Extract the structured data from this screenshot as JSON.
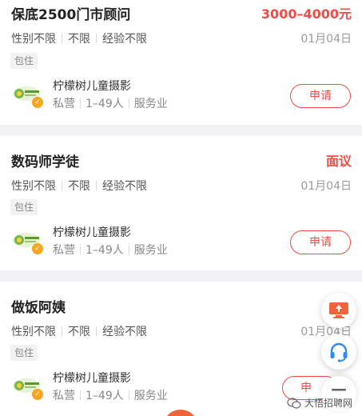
{
  "listings": [
    {
      "title": "保底2500门市顾问",
      "salary": "3000–4000元",
      "requirements": [
        "性别不限",
        "不限",
        "经验不限"
      ],
      "date": "01月04日",
      "tag": "包住",
      "company": {
        "name": "柠檬树儿童摄影",
        "type": "私营",
        "size": "1–49人",
        "industry": "服务业"
      },
      "apply_label": "申请"
    },
    {
      "title": "数码师学徒",
      "salary": "面议",
      "requirements": [
        "性别不限",
        "不限",
        "经验不限"
      ],
      "date": "01月04日",
      "tag": "包住",
      "company": {
        "name": "柠檬树儿童摄影",
        "type": "私营",
        "size": "1–49人",
        "industry": "服务业"
      },
      "apply_label": "申请"
    },
    {
      "title": "做饭阿姨",
      "salary": "",
      "requirements": [
        "性别不限",
        "不限",
        "经验不限"
      ],
      "date": "01月04日",
      "tag": "包住",
      "company": {
        "name": "柠檬树儿童摄影",
        "type": "私营",
        "size": "1–49人",
        "industry": "服务业"
      },
      "apply_label": "申"
    }
  ],
  "floating": {
    "post_icon": "monitor-upload-icon",
    "service_icon": "headset-icon",
    "menu_icon": "menu-icon"
  },
  "watermark": {
    "text": "大悟招聘网"
  },
  "colors": {
    "accent": "#f04b44",
    "verified": "#f5a623",
    "service": "#2d8cf0"
  }
}
